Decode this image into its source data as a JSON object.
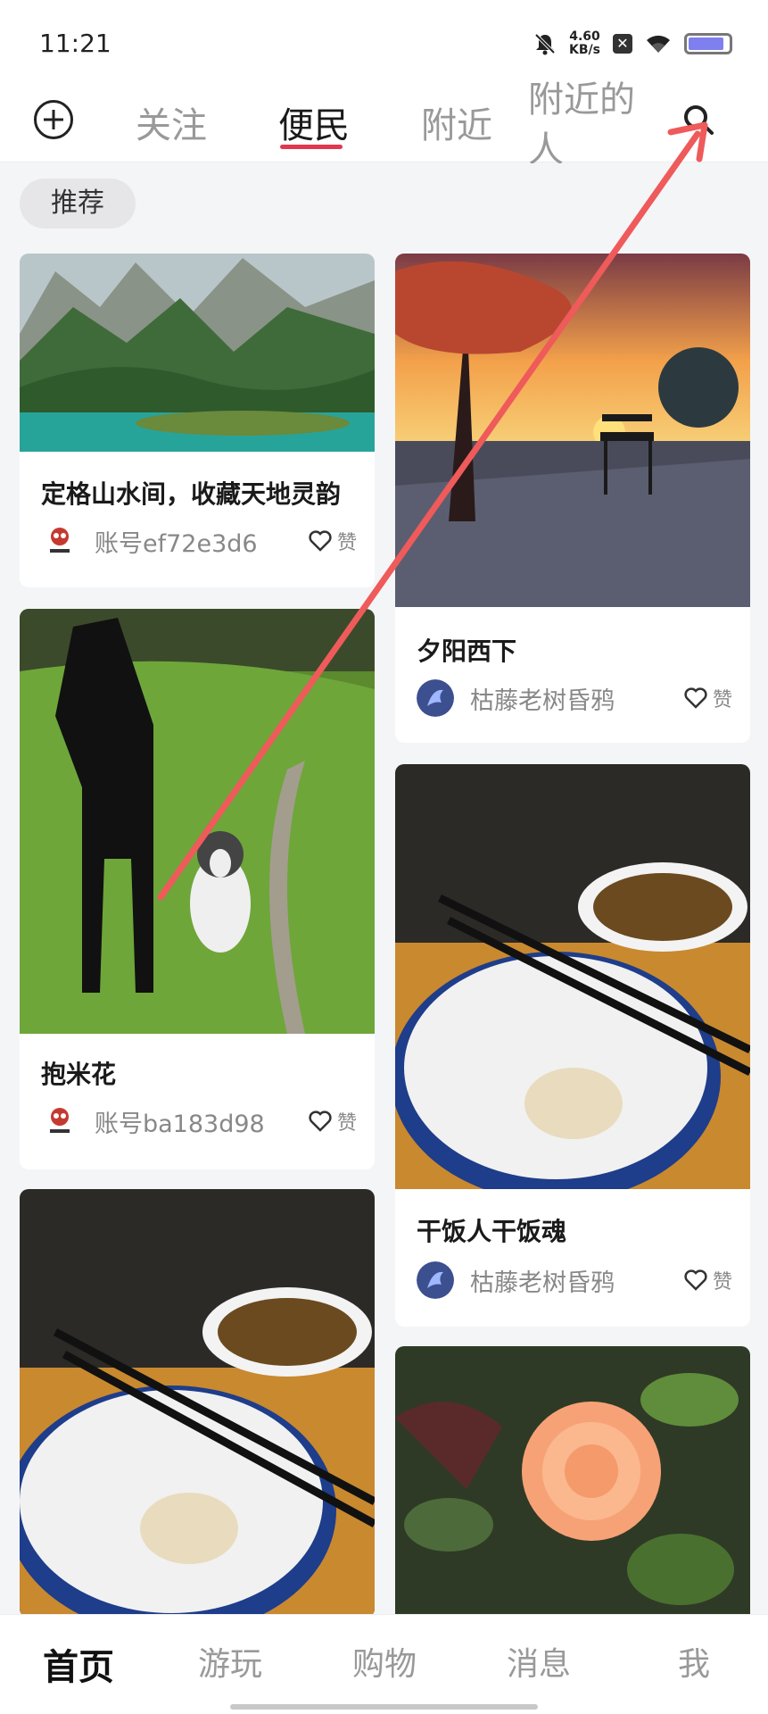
{
  "status_bar": {
    "time": "11:21",
    "net_speed_value": "4.60",
    "net_speed_unit": "KB/s",
    "icons": [
      "mute-bell-icon",
      "x-box-icon",
      "wifi-icon",
      "battery-icon"
    ]
  },
  "header": {
    "add_icon": "plus-circle-icon",
    "tabs": [
      {
        "label": "关注"
      },
      {
        "label": "便民"
      },
      {
        "label": "附近"
      },
      {
        "label": "附近的人"
      }
    ],
    "active_tab": "便民",
    "search_icon": "search-icon"
  },
  "filter": {
    "chip": "推荐"
  },
  "feed": {
    "left": [
      {
        "title": "定格山水间，收藏天地灵韵",
        "author": "账号ef72e3d6",
        "like": "赞"
      },
      {
        "title": "抱米花",
        "author": "账号ba183d98",
        "like": "赞"
      },
      {
        "title": "",
        "author": "",
        "like": ""
      }
    ],
    "right": [
      {
        "title": "夕阳西下",
        "author": "枯藤老树昏鸦",
        "like": "赞"
      },
      {
        "title": "干饭人干饭魂",
        "author": "枯藤老树昏鸦",
        "like": "赞"
      },
      {
        "title": "",
        "author": "",
        "like": ""
      }
    ]
  },
  "bottom_nav": {
    "items": [
      {
        "label": "首页"
      },
      {
        "label": "游玩"
      },
      {
        "label": "购物"
      },
      {
        "label": "消息"
      },
      {
        "label": "我"
      }
    ],
    "active": "首页"
  },
  "colors": {
    "accent": "#e0384f",
    "annotation_arrow": "#ef5a5a"
  }
}
